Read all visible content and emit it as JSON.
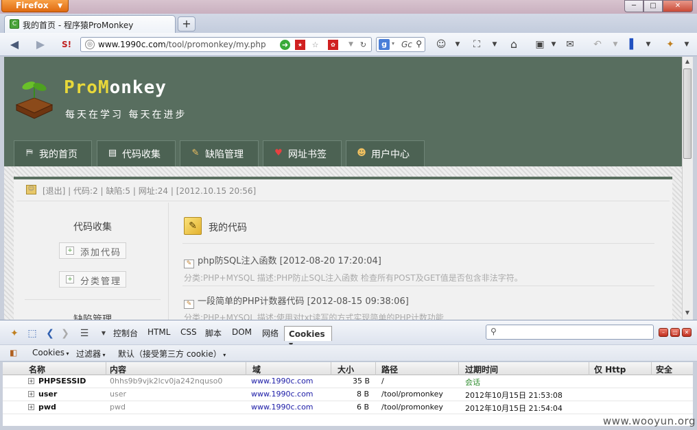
{
  "window": {
    "firefox_button": "Firefox",
    "controls": {
      "minimize": "─",
      "maximize": "□",
      "close": "✕"
    }
  },
  "tab": {
    "title": "我的首页 - 程序猿ProMonkey",
    "new_tab": "+"
  },
  "nav": {
    "url_prefix": "www.1990c.com",
    "url_path": "/tool/promonkey/my.php",
    "search_placeholder": "Gc",
    "search_engine": "g"
  },
  "site": {
    "logo_pro": "Pro",
    "logo_m": "M",
    "logo_rest": "onkey",
    "slogan": "每天在学习 每天在进步",
    "menu": [
      {
        "label": "我的首页",
        "icon": "signpost-icon"
      },
      {
        "label": "代码收集",
        "icon": "notepad-icon"
      },
      {
        "label": "缺陷管理",
        "icon": "wrench-icon"
      },
      {
        "label": "网址书签",
        "icon": "heart-icon"
      },
      {
        "label": "用户中心",
        "icon": "user-icon"
      }
    ],
    "infobar": "[退出] | 代码:2 | 缺陷:5 | 网址:24 | [2012.10.15 20:56]",
    "sidebar": {
      "title": "代码收集",
      "buttons": [
        "添加代码",
        "分类管理"
      ],
      "title2": "缺陷管理"
    },
    "main": {
      "title": "我的代码",
      "items": [
        {
          "title": "php防SQL注入函数 [2012-08-20 17:20:04]",
          "meta": "分类:PHP+MYSQL     描述:PHP防止SQL注入函数 检查所有POST及GET值是否包含非法字符。"
        },
        {
          "title": "一段简单的PHP计数器代码 [2012-08-15 09:38:06]",
          "meta": "分类:PHP+MYSQL     描述:使用对txt读写的方式实现简单的PHP计数功能"
        }
      ]
    }
  },
  "firebug": {
    "tabs": [
      "控制台",
      "HTML",
      "CSS",
      "脚本",
      "DOM",
      "网络"
    ],
    "active_tab": "Cookies",
    "subbar": {
      "cookies": "Cookies",
      "filter": "过滤器",
      "default": "默认（接受第三方 cookie）"
    },
    "columns": [
      "名称",
      "内容",
      "域",
      "大小",
      "路径",
      "过期时间",
      "仅 Http",
      "安全"
    ],
    "rows": [
      {
        "name": "PHPSESSID",
        "content": "0hhs9b9vjk2lcv0ja242nquso0",
        "domain": "www.1990c.com",
        "size": "35 B",
        "path": "/",
        "expires": "会话"
      },
      {
        "name": "user",
        "content": "user",
        "domain": "www.1990c.com",
        "size": "8 B",
        "path": "/tool/promonkey",
        "expires": "2012年10月15日 21:53:08"
      },
      {
        "name": "pwd",
        "content": "pwd",
        "domain": "www.1990c.com",
        "size": "6 B",
        "path": "/tool/promonkey",
        "expires": "2012年10月15日 21:54:04"
      }
    ]
  },
  "watermark": "www.wooyun.org",
  "colors": {
    "header_bg": "#586e5f",
    "firefox_orange": "#e06a10",
    "domain_link": "#1a1aa6",
    "session_green": "#2a8a2a"
  }
}
